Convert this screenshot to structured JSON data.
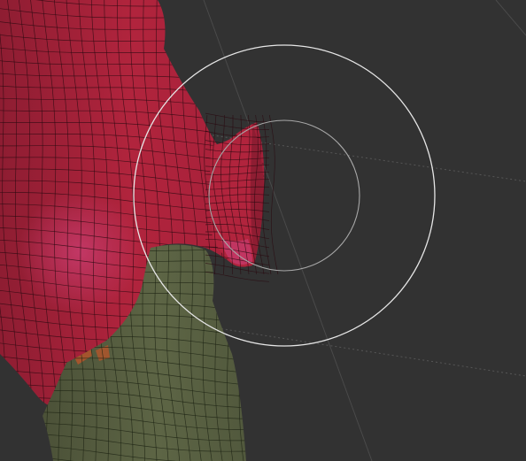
{
  "viewport": {
    "background_color": "#323232",
    "grid_color": "#4a4a4a",
    "grid_dash_color": "#6a6a6a"
  },
  "mesh": {
    "mask_red_color": "#b1243d",
    "mask_red_dark_color": "#8e1d32",
    "highlight_color": "#c63a6a",
    "unmasked_color": "#5d6545",
    "unmasked_dark_color": "#454a33",
    "wire_color": "#2a0a10",
    "orange_patch_color": "#b3552a"
  },
  "brush_cursor": {
    "outer_ring_color": "#e6e6e6",
    "inner_ring_color": "#a8a8a8",
    "icon": "brush-cursor-icon"
  }
}
